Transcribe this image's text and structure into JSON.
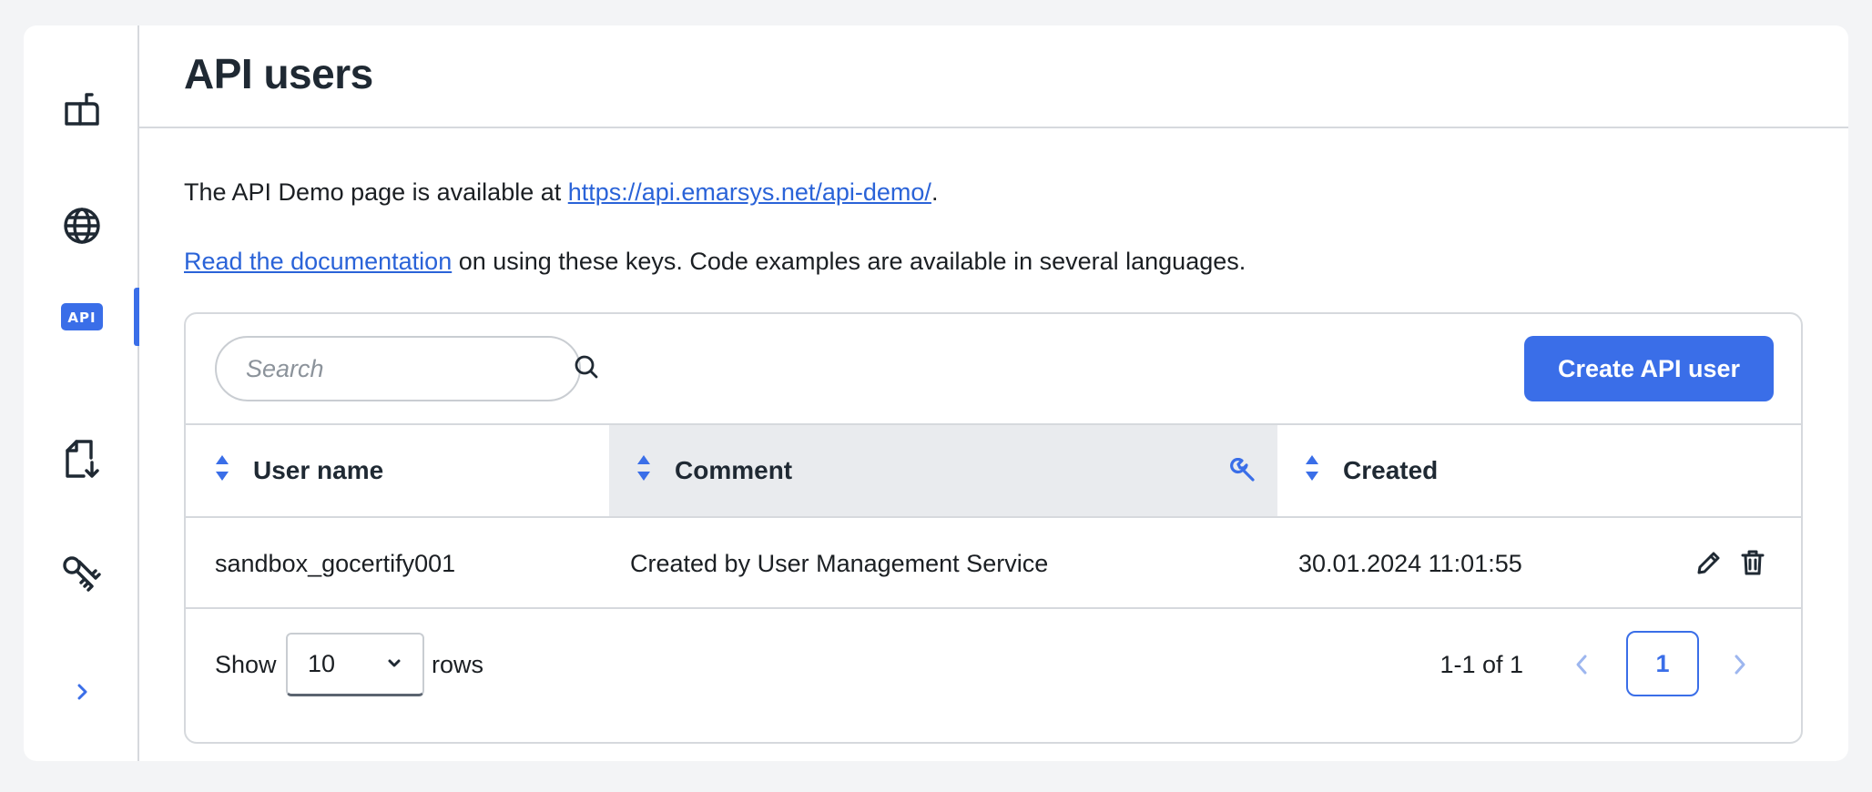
{
  "page": {
    "title": "API users"
  },
  "sidebar": {
    "items": [
      {
        "icon": "mailbox-icon"
      },
      {
        "icon": "globe-icon"
      },
      {
        "icon": "api-icon",
        "active": true
      },
      {
        "icon": "file-download-icon"
      },
      {
        "icon": "keys-icon"
      },
      {
        "icon": "chevron-right-icon"
      }
    ]
  },
  "info": {
    "line1_prefix": "The API Demo page is available at ",
    "line1_link": "https://api.emarsys.net/api-demo/",
    "line1_suffix": ".",
    "line2_link": "Read the documentation",
    "line2_suffix": " on using these keys. Code examples are available in several languages."
  },
  "toolbar": {
    "search_placeholder": "Search",
    "create_label": "Create API user"
  },
  "table": {
    "columns": [
      "User name",
      "Comment",
      "Created"
    ],
    "rows": [
      {
        "user_name": "sandbox_gocertify001",
        "comment": "Created by User Management Service",
        "created": "30.01.2024 11:01:55"
      }
    ]
  },
  "pagination": {
    "show_label": "Show",
    "rows_value": "10",
    "rows_label": "rows",
    "range": "1-1 of 1",
    "current_page": "1"
  },
  "colors": {
    "accent": "#3a6ee8",
    "link": "#2a63d8",
    "highlighted_column": "#e9ebee"
  }
}
